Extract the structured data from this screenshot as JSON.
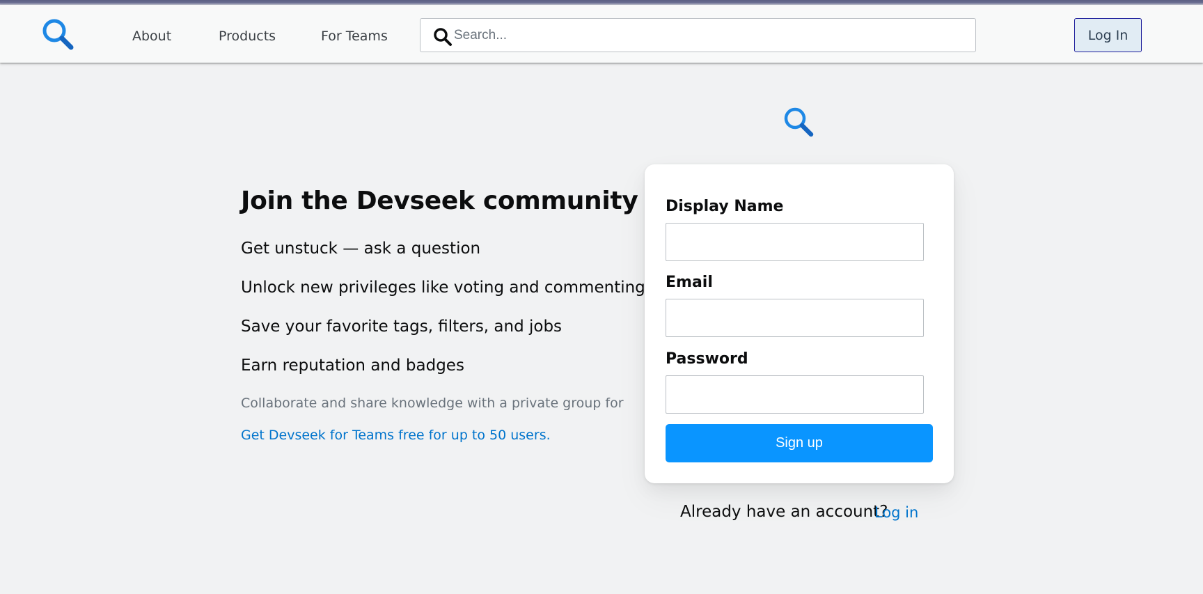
{
  "nav": {
    "logo_icon": "magnifier-logo-icon",
    "links": [
      "About",
      "Products",
      "For Teams"
    ],
    "search": {
      "icon": "search-icon",
      "placeholder": "Search...",
      "value": ""
    },
    "login_label": "Log In"
  },
  "hero": {
    "logo_icon": "magnifier-logo-icon",
    "title": "Join the Devseek community",
    "benefits": [
      "Get unstuck — ask a question",
      "Unlock new privileges like voting and commenting",
      "Save your favorite tags, filters, and jobs",
      "Earn reputation and badges"
    ],
    "collab_text": "Collaborate and share knowledge with a private group for",
    "teams_link": "Get Devseek for Teams free for up to 50 users."
  },
  "form": {
    "fields": [
      {
        "label": "Display Name",
        "value": ""
      },
      {
        "label": "Email",
        "value": ""
      },
      {
        "label": "Password",
        "value": ""
      }
    ],
    "submit_label": "Sign up",
    "already_text": "Already have an account?",
    "login_link": "Log in"
  },
  "colors": {
    "accent_blue": "#0a95ff",
    "link_blue": "#0074cc",
    "logo_blue": "#1e88e5",
    "page_bg": "#f1f2f3",
    "nav_bg": "#f8f9f9"
  }
}
